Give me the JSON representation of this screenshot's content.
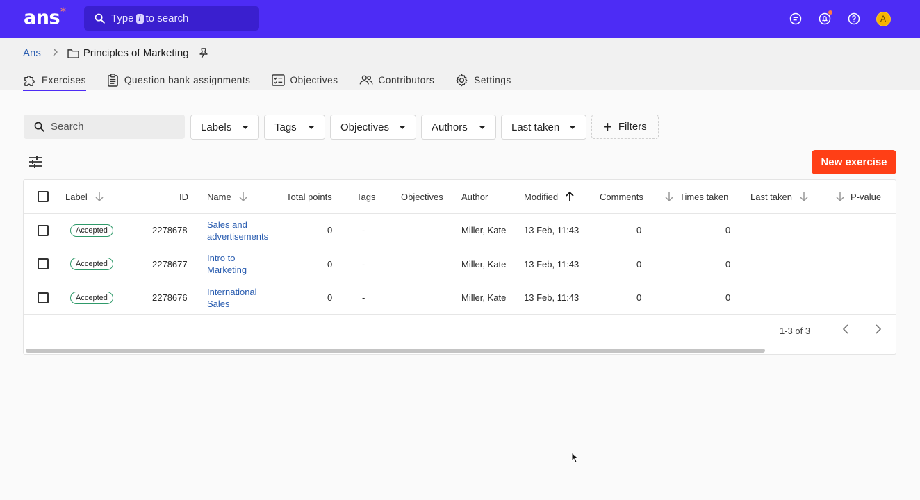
{
  "app": {
    "logo_text": "ans",
    "logo_star": "*",
    "search": {
      "prefix": "Type",
      "key": "/",
      "suffix": "to search"
    },
    "avatar_initial": "A",
    "brand_color": "#4d2cf5",
    "accent_color": "#ff3f16"
  },
  "breadcrumb": {
    "root": "Ans",
    "current": "Principles of Marketing"
  },
  "tabs": [
    {
      "label": "Exercises",
      "icon": "puzzle-icon",
      "active": true
    },
    {
      "label": "Question bank assignments",
      "icon": "clipboard-icon"
    },
    {
      "label": "Objectives",
      "icon": "checklist-icon"
    },
    {
      "label": "Contributors",
      "icon": "people-icon"
    },
    {
      "label": "Settings",
      "icon": "gear-icon"
    }
  ],
  "filters": {
    "search_placeholder": "Search",
    "labels": "Labels",
    "tags": "Tags",
    "objectives": "Objectives",
    "authors": "Authors",
    "last_taken": "Last taken",
    "more": "Filters"
  },
  "new_exercise": "New exercise",
  "table": {
    "columns": {
      "label": "Label",
      "id": "ID",
      "name": "Name",
      "total_points": "Total points",
      "tags": "Tags",
      "objectives": "Objectives",
      "author": "Author",
      "modified": "Modified",
      "comments": "Comments",
      "times_taken": "Times taken",
      "last_taken": "Last taken",
      "p_value": "P-value"
    },
    "rows": [
      {
        "label": "Accepted",
        "id": "2278678",
        "name_line1": "Sales and",
        "name_line2": "advertisements",
        "total_points": "0",
        "tags": "-",
        "author": "Miller, Kate",
        "modified": "13 Feb, 11:43",
        "comments": "0",
        "times_taken": "0"
      },
      {
        "label": "Accepted",
        "id": "2278677",
        "name_line1": "Intro to",
        "name_line2": "Marketing",
        "total_points": "0",
        "tags": "-",
        "author": "Miller, Kate",
        "modified": "13 Feb, 11:43",
        "comments": "0",
        "times_taken": "0"
      },
      {
        "label": "Accepted",
        "id": "2278676",
        "name_line1": "International",
        "name_line2": "Sales",
        "total_points": "0",
        "tags": "-",
        "author": "Miller, Kate",
        "modified": "13 Feb, 11:43",
        "comments": "0",
        "times_taken": "0"
      }
    ],
    "pagination": "1-3 of 3"
  }
}
